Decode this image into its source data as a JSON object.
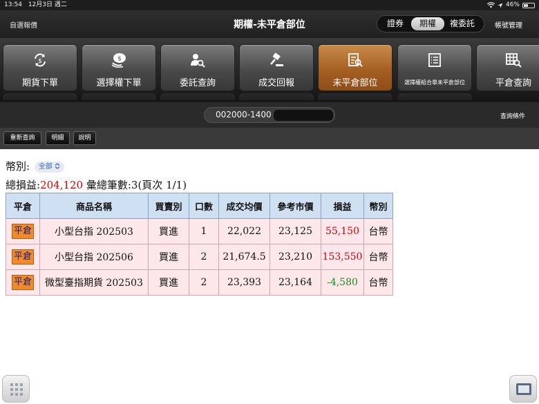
{
  "status_bar": {
    "time": "13:54",
    "date": "12月3日 週二",
    "battery": "46%",
    "battery_level": 0.46
  },
  "nav": {
    "favorites": "自選報價",
    "title": "期權-未平倉部位",
    "segments": [
      "證券",
      "期權",
      "複委託"
    ],
    "selected_segment": "期權",
    "account_mgmt": "帳號管理"
  },
  "toolbar": {
    "items": [
      {
        "label": "期貨下單",
        "icon": "dollar-refresh-icon"
      },
      {
        "label": "選擇權下單",
        "icon": "coin-stack-icon"
      },
      {
        "label": "委託查詢",
        "icon": "person-search-icon"
      },
      {
        "label": "成交回報",
        "icon": "gavel-icon"
      },
      {
        "label": "未平倉部位",
        "icon": "document-search-icon",
        "active": true
      },
      {
        "label": "選擇權組合單未平倉部位",
        "icon": "list-document-icon"
      },
      {
        "label": "平倉查詢",
        "icon": "grid-search-icon"
      }
    ],
    "active_color": "#b46a2c"
  },
  "account": {
    "number": "002000-1400",
    "query_conditions": "查詢條件"
  },
  "actions": {
    "refresh": "重新查詢",
    "detail": "明細",
    "help": "說明"
  },
  "filter": {
    "currency_label": "幣別:",
    "currency_value": "全部"
  },
  "summary": {
    "total_pl_label": "總損益:",
    "total_pl_value": "204,120",
    "count_text": " 彙總筆數:3(頁次 1/1)"
  },
  "table": {
    "headers": [
      "平倉",
      "商品名稱",
      "買賣別",
      "口數",
      "成交均價",
      "參考市價",
      "損益",
      "幣別"
    ],
    "rows": [
      {
        "action": "平倉",
        "product": "小型台指 202503",
        "side": "買進",
        "qty": "1",
        "avg_price": "22,022",
        "ref_price": "23,125",
        "pl": "55,150",
        "pl_sign": "positive",
        "currency": "台幣"
      },
      {
        "action": "平倉",
        "product": "小型台指 202506",
        "side": "買進",
        "qty": "2",
        "avg_price": "21,674.5",
        "ref_price": "23,210",
        "pl": "153,550",
        "pl_sign": "positive",
        "currency": "台幣"
      },
      {
        "action": "平倉",
        "product": "微型臺指期貨 202503",
        "side": "買進",
        "qty": "2",
        "avg_price": "23,393",
        "ref_price": "23,164",
        "pl": "-4,580",
        "pl_sign": "negative",
        "currency": "台幣"
      }
    ],
    "colors": {
      "header_bg": "#cfe0f3",
      "row_bg": "#fde7ea",
      "positive": "#d40000",
      "negative": "#188a18"
    }
  },
  "corners": {
    "left_icon": "grid-menu-icon",
    "right_icon": "window-icon"
  }
}
